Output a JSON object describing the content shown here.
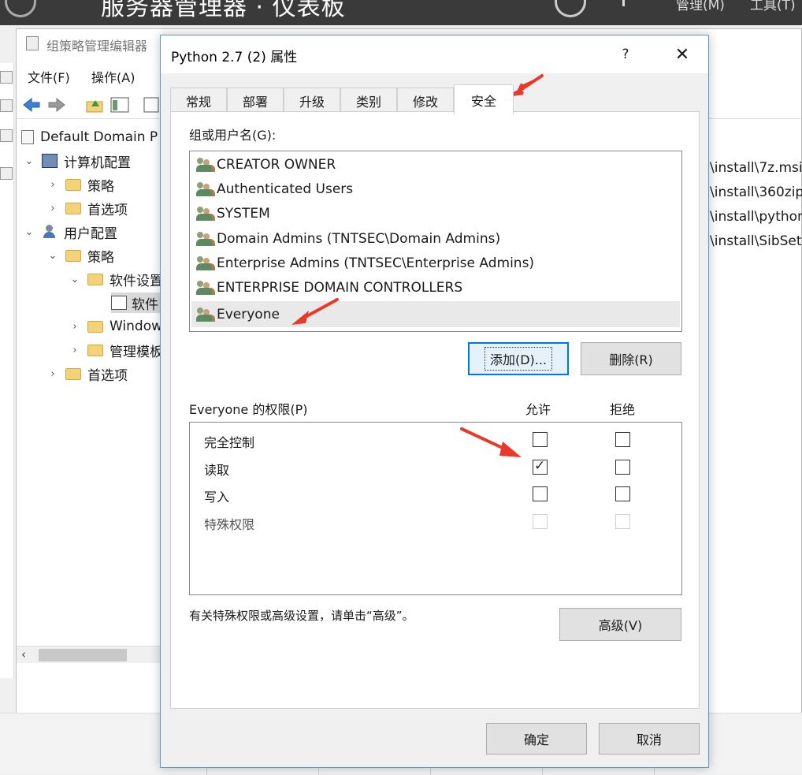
{
  "server_manager": {
    "title": "服务器管理器 · 仪表板",
    "menu_manage": "管理(M)",
    "menu_tools": "工具(T)"
  },
  "gpo_editor": {
    "title": "组策略管理编辑器",
    "menu": [
      "文件(F)",
      "操作(A)"
    ],
    "tree": {
      "root": "Default Domain P",
      "computer_config": "计算机配置",
      "cc_policies": "策略",
      "cc_preferences": "首选项",
      "user_config": "用户配置",
      "uc_policies": "策略",
      "software_settings": "软件设置",
      "software_install": "软件",
      "windows_settings": "Window",
      "admin_templates": "管理模板",
      "uc_preferences": "首选项"
    },
    "paths": [
      "\\install\\7z.msi",
      "\\install\\360zip",
      "\\install\\python",
      "\\install\\SibSet"
    ]
  },
  "dialog": {
    "title": "Python 2.7 (2) 属性",
    "help": "?",
    "close": "✕",
    "tabs": [
      "常规",
      "部署",
      "升级",
      "类别",
      "修改",
      "安全"
    ],
    "active_tab": "安全",
    "group_label": "组或用户名(G):",
    "users": [
      "CREATOR OWNER",
      "Authenticated Users",
      "SYSTEM",
      "Domain Admins (TNTSEC\\Domain Admins)",
      "Enterprise Admins (TNTSEC\\Enterprise Admins)",
      "ENTERPRISE DOMAIN CONTROLLERS",
      "Everyone"
    ],
    "selected_user": "Everyone",
    "add_button": "添加(D)...",
    "remove_button": "删除(R)",
    "perm_label": "Everyone 的权限(P)",
    "allow_header": "允许",
    "deny_header": "拒绝",
    "permissions": [
      {
        "name": "完全控制",
        "allow": false,
        "deny": false,
        "disabled": false
      },
      {
        "name": "读取",
        "allow": true,
        "deny": false,
        "disabled": false
      },
      {
        "name": "写入",
        "allow": false,
        "deny": false,
        "disabled": false
      },
      {
        "name": "特殊权限",
        "allow": false,
        "deny": false,
        "disabled": true
      }
    ],
    "advanced_hint": "有关特殊权限或高级设置，请单击“高级”。",
    "advanced_button": "高级(V)",
    "ok_button": "确定",
    "cancel_button": "取消"
  },
  "colors": {
    "annotation_arrow": "#e8392c",
    "accent": "#0078d7"
  }
}
